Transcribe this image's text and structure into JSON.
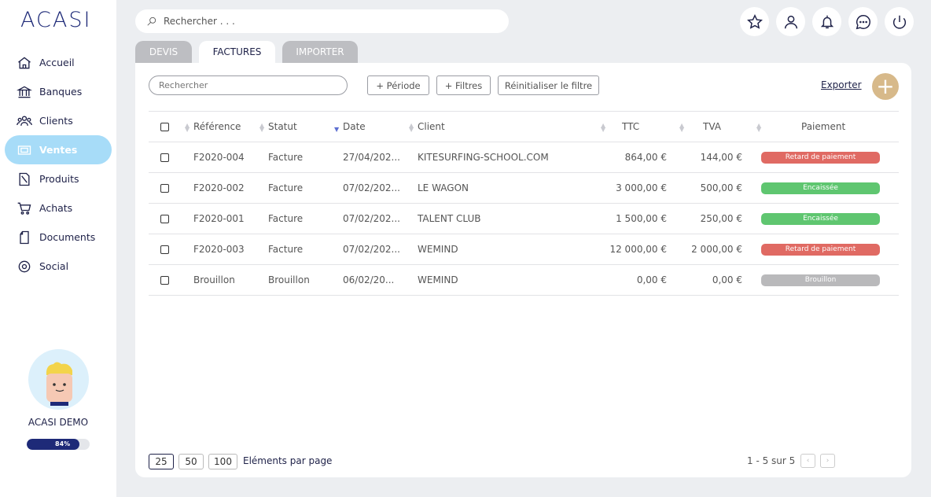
{
  "app": {
    "logo": "ACASI"
  },
  "sidebar": {
    "items": [
      {
        "label": "Accueil",
        "icon": "home-icon"
      },
      {
        "label": "Banques",
        "icon": "bank-icon"
      },
      {
        "label": "Clients",
        "icon": "people-icon"
      },
      {
        "label": "Ventes",
        "icon": "sales-icon"
      },
      {
        "label": "Produits",
        "icon": "products-icon"
      },
      {
        "label": "Achats",
        "icon": "cart-icon"
      },
      {
        "label": "Documents",
        "icon": "document-icon"
      },
      {
        "label": "Social",
        "icon": "social-icon"
      }
    ],
    "active": "Ventes"
  },
  "user": {
    "name": "ACASI DEMO",
    "progress_label": "84%",
    "progress": 0.84
  },
  "top_search": {
    "placeholder": "Rechercher . . ."
  },
  "top_icons": [
    "star-icon",
    "user-icon",
    "bell-icon",
    "chat-icon",
    "power-icon"
  ],
  "tabs": [
    {
      "label": "DEVIS"
    },
    {
      "label": "FACTURES"
    },
    {
      "label": "IMPORTER"
    }
  ],
  "active_tab": "FACTURES",
  "filters": {
    "search_placeholder": "Rechercher",
    "period": "+ Période",
    "filters": "+ Filtres",
    "reset": "Réinitialiser le filtre",
    "export": "Exporter",
    "add": "+"
  },
  "table": {
    "headers": {
      "reference": "Référence",
      "status": "Statut",
      "date": "Date",
      "client": "Client",
      "ttc": "TTC",
      "tva": "TVA",
      "payment": "Paiement"
    },
    "rows": [
      {
        "reference": "F2020-004",
        "status": "Facture",
        "date": "27/04/202...",
        "client": "KITESURFING-SCHOOL.COM",
        "ttc": "864,00 €",
        "tva": "144,00 €",
        "payment": "Retard de paiement",
        "color": "#e06a63"
      },
      {
        "reference": "F2020-002",
        "status": "Facture",
        "date": "07/02/202...",
        "client": "LE WAGON",
        "ttc": "3 000,00 €",
        "tva": "500,00 €",
        "payment": "Encaissée",
        "color": "#5fc670"
      },
      {
        "reference": "F2020-001",
        "status": "Facture",
        "date": "07/02/202...",
        "client": "TALENT CLUB",
        "ttc": "1 500,00 €",
        "tva": "250,00 €",
        "payment": "Encaissée",
        "color": "#5fc670"
      },
      {
        "reference": "F2020-003",
        "status": "Facture",
        "date": "07/02/202...",
        "client": "WEMIND",
        "ttc": "12 000,00 €",
        "tva": "2 000,00 €",
        "payment": "Retard de paiement",
        "color": "#e06a63"
      },
      {
        "reference": "Brouillon",
        "status": "Brouillon",
        "date": "06/02/20...",
        "client": "WEMIND",
        "ttc": "0,00 €",
        "tva": "0,00 €",
        "payment": "Brouillon",
        "color": "#b9b9bb"
      }
    ]
  },
  "pagination": {
    "sizes": [
      "25",
      "50",
      "100"
    ],
    "active_size": "25",
    "per_page_label": "Eléments par page",
    "count": "1 - 5 sur 5",
    "prev": "‹",
    "next": "›"
  },
  "colors": {
    "navy": "#1e2148",
    "active_nav": "#a7dcf8",
    "add_button": "#d7b98a",
    "late": "#e06a63",
    "paid": "#5fc670",
    "draft": "#b9b9bb"
  }
}
